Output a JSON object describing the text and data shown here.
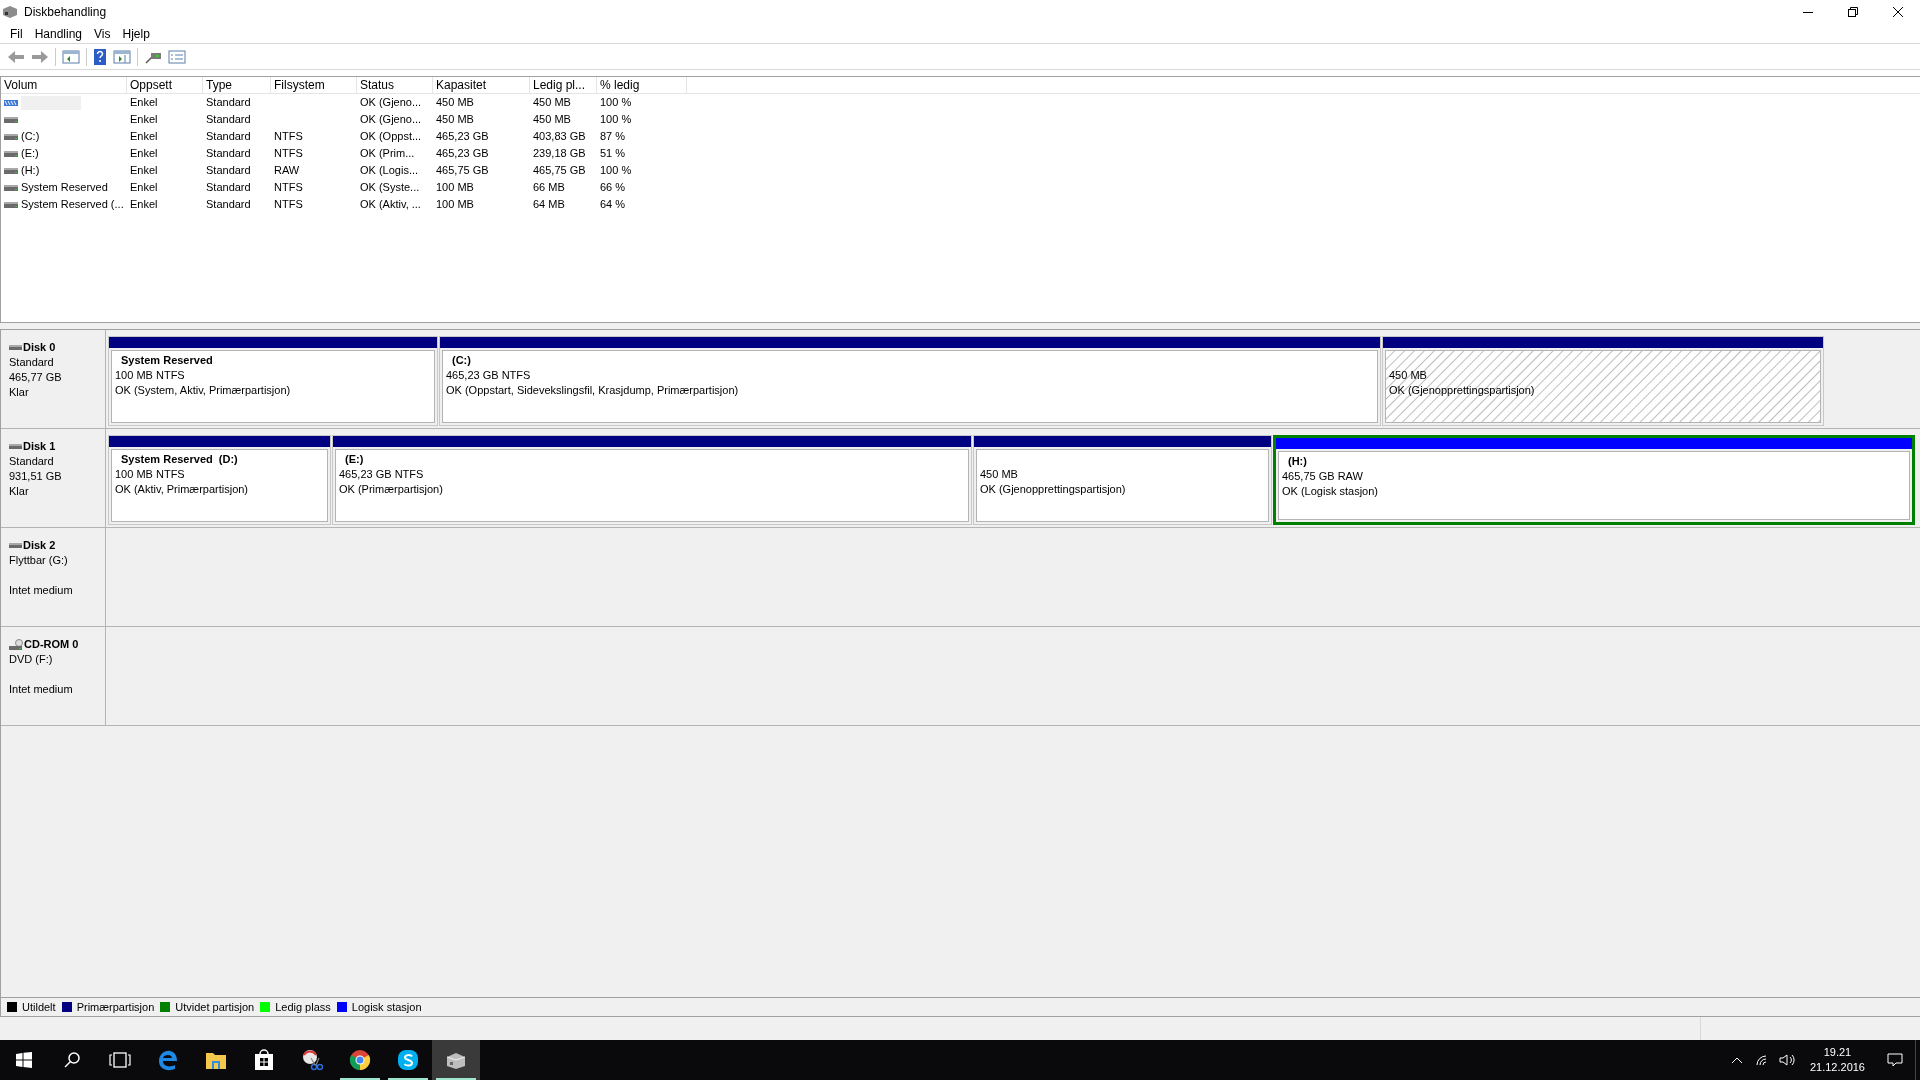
{
  "window": {
    "title": "Diskbehandling"
  },
  "menu": [
    "Fil",
    "Handling",
    "Vis",
    "Hjelp"
  ],
  "table": {
    "columns": [
      "Volum",
      "Oppsett",
      "Type",
      "Filsystem",
      "Status",
      "Kapasitet",
      "Ledig pl...",
      "% ledig"
    ],
    "rows": [
      {
        "kind": "recovery",
        "selected": true,
        "layout": "Enkel",
        "type": "Standard",
        "status": "OK (Gjeno...",
        "capacity": "450 MB",
        "free_space": "450 MB",
        "percent_free": "100 %"
      },
      {
        "kind": "drive",
        "selected": false,
        "layout": "Enkel",
        "type": "Standard",
        "status": "OK (Gjeno...",
        "capacity": "450 MB",
        "free_space": "450 MB",
        "percent_free": "100 %"
      },
      {
        "kind": "drive",
        "selected": false,
        "volume": "(C:)",
        "layout": "Enkel",
        "type": "Standard",
        "file_system": "NTFS",
        "status": "OK (Oppst...",
        "capacity": "465,23 GB",
        "free_space": "403,83 GB",
        "percent_free": "87 %"
      },
      {
        "kind": "drive",
        "selected": false,
        "volume": "(E:)",
        "layout": "Enkel",
        "type": "Standard",
        "file_system": "NTFS",
        "status": "OK (Prim...",
        "capacity": "465,23 GB",
        "free_space": "239,18 GB",
        "percent_free": "51 %"
      },
      {
        "kind": "drive",
        "selected": false,
        "volume": "(H:)",
        "layout": "Enkel",
        "type": "Standard",
        "file_system": "RAW",
        "status": "OK (Logis...",
        "capacity": "465,75 GB",
        "free_space": "465,75 GB",
        "percent_free": "100 %"
      },
      {
        "kind": "drive",
        "selected": false,
        "volume": "System Reserved",
        "layout": "Enkel",
        "type": "Standard",
        "file_system": "NTFS",
        "status": "OK (Syste...",
        "capacity": "100 MB",
        "free_space": "66 MB",
        "percent_free": "66 %"
      },
      {
        "kind": "drive",
        "selected": false,
        "volume": "System Reserved (...",
        "layout": "Enkel",
        "type": "Standard",
        "file_system": "NTFS",
        "status": "OK (Aktiv, ...",
        "capacity": "100 MB",
        "free_space": "64 MB",
        "percent_free": "64 %"
      }
    ]
  },
  "disks": [
    {
      "kind": "disk",
      "name": "Disk 0",
      "type": "Standard",
      "size": "465,77 GB",
      "state": "Klar",
      "partitions": [
        {
          "kind": "primary",
          "selected": false,
          "hatched": false,
          "title": "System Reserved",
          "size": "100 MB NTFS",
          "status": "OK (System, Aktiv, Primærpartisjon)"
        },
        {
          "kind": "primary",
          "selected": false,
          "hatched": false,
          "title": "(C:)",
          "size": "465,23 GB NTFS",
          "status": "OK (Oppstart, Sidevekslingsfil, Krasjdump, Primærpartisjon)"
        },
        {
          "kind": "primary",
          "selected": false,
          "hatched": true,
          "size": "450 MB",
          "status": "OK (Gjenopprettingspartisjon)"
        }
      ]
    },
    {
      "kind": "disk",
      "name": "Disk 1",
      "type": "Standard",
      "size": "931,51 GB",
      "state": "Klar",
      "partitions": [
        {
          "kind": "primary",
          "selected": false,
          "hatched": false,
          "title": "System Reserved  (D:)",
          "size": "100 MB NTFS",
          "status": "OK (Aktiv, Primærpartisjon)"
        },
        {
          "kind": "primary",
          "selected": false,
          "hatched": false,
          "title": "(E:)",
          "size": "465,23 GB NTFS",
          "status": "OK (Primærpartisjon)"
        },
        {
          "kind": "primary",
          "selected": false,
          "hatched": false,
          "size": "450 MB",
          "status": "OK (Gjenopprettingspartisjon)"
        },
        {
          "kind": "logical",
          "selected": true,
          "hatched": false,
          "title": "(H:)",
          "size": "465,75 GB RAW",
          "status": "OK (Logisk stasjon)"
        }
      ]
    },
    {
      "kind": "disk",
      "name": "Disk 2",
      "type": "Flyttbar (G:)",
      "state": "Intet medium"
    },
    {
      "kind": "cdrom",
      "name": "CD-ROM 0",
      "type": "DVD (F:)",
      "state": "Intet medium"
    }
  ],
  "legend": [
    {
      "label": "Utildelt",
      "color": "#000000"
    },
    {
      "label": "Primærpartisjon",
      "color": "#000080"
    },
    {
      "label": "Utvidet partisjon",
      "color": "#008000"
    },
    {
      "label": "Ledig plass",
      "color": "#00ff00"
    },
    {
      "label": "Logisk stasjon",
      "color": "#0000ff"
    }
  ],
  "taskbar": {
    "apps": [
      {
        "kind": "start",
        "running": false,
        "selected": false
      },
      {
        "kind": "search",
        "running": false,
        "selected": false
      },
      {
        "kind": "taskview",
        "running": false,
        "selected": false
      },
      {
        "kind": "edge",
        "running": false,
        "selected": false
      },
      {
        "kind": "explorer",
        "running": false,
        "selected": false
      },
      {
        "kind": "store",
        "running": false,
        "selected": false
      },
      {
        "kind": "snipping",
        "running": false,
        "selected": false
      },
      {
        "kind": "chrome",
        "running": true,
        "selected": false
      },
      {
        "kind": "skype",
        "running": true,
        "selected": false
      },
      {
        "kind": "diskmgmt",
        "running": true,
        "selected": true
      }
    ],
    "time": "19.21",
    "date": "21.12.2016"
  }
}
